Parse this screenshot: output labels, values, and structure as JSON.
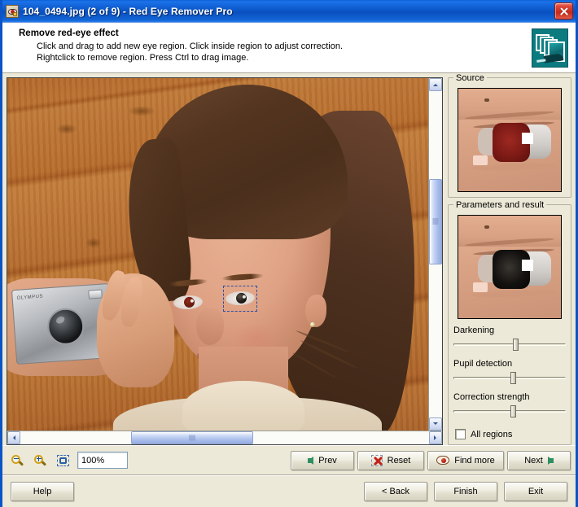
{
  "window": {
    "title": "104_0494.jpg (2 of 9) - Red Eye Remover Pro",
    "icon": "red-eye-app-icon",
    "close_label": "✕"
  },
  "header": {
    "title": "Remove red-eye effect",
    "line1": "Click and drag to add new eye region. Click inside region to adjust correction.",
    "line2": "Rightclick to remove region. Press Ctrl to drag image.",
    "logo": "photo-stack-logo"
  },
  "image_view": {
    "description": "Photo of a young woman holding a silver compact camera in front of a wooden plank wall",
    "selection": "eye-region-selection",
    "vscroll": "vertical-scrollbar",
    "hscroll": "horizontal-scrollbar"
  },
  "sidebar": {
    "source": {
      "title": "Source",
      "preview": "source-eye-preview-red"
    },
    "result": {
      "title": "Parameters and result",
      "preview": "result-eye-preview-corrected"
    },
    "sliders": [
      {
        "label": "Darkening",
        "value": 55
      },
      {
        "label": "Pupil detection",
        "value": 53
      },
      {
        "label": "Correction strength",
        "value": 53
      }
    ],
    "all_regions": {
      "label": "All regions",
      "checked": false
    }
  },
  "toolbar": {
    "zoom_out": "zoom-out",
    "zoom_in": "zoom-in",
    "fit": "fit-to-window",
    "zoom_value": "100%",
    "prev_label": "Prev",
    "reset_label": "Reset",
    "find_more_label": "Find more",
    "next_label": "Next"
  },
  "footer": {
    "help_label": "Help",
    "back_label": "< Back",
    "finish_label": "Finish",
    "exit_label": "Exit"
  },
  "colors": {
    "titlebar_blue": "#0a54c8",
    "dialog_face": "#ece9d8",
    "accent_green": "#2f8f63",
    "accent_red": "#c0221c",
    "logo_teal": "#0b7b7f"
  }
}
